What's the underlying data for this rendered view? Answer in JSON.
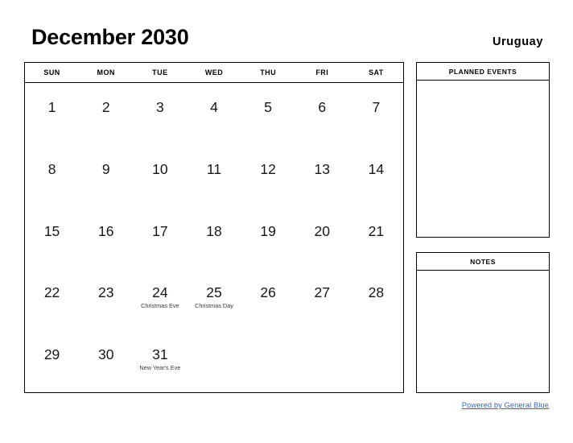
{
  "header": {
    "title": "December 2030",
    "country": "Uruguay"
  },
  "calendar": {
    "weekdays": [
      "SUN",
      "MON",
      "TUE",
      "WED",
      "THU",
      "FRI",
      "SAT"
    ],
    "weeks": [
      [
        {
          "day": "1",
          "event": ""
        },
        {
          "day": "2",
          "event": ""
        },
        {
          "day": "3",
          "event": ""
        },
        {
          "day": "4",
          "event": ""
        },
        {
          "day": "5",
          "event": ""
        },
        {
          "day": "6",
          "event": ""
        },
        {
          "day": "7",
          "event": ""
        }
      ],
      [
        {
          "day": "8",
          "event": ""
        },
        {
          "day": "9",
          "event": ""
        },
        {
          "day": "10",
          "event": ""
        },
        {
          "day": "11",
          "event": ""
        },
        {
          "day": "12",
          "event": ""
        },
        {
          "day": "13",
          "event": ""
        },
        {
          "day": "14",
          "event": ""
        }
      ],
      [
        {
          "day": "15",
          "event": ""
        },
        {
          "day": "16",
          "event": ""
        },
        {
          "day": "17",
          "event": ""
        },
        {
          "day": "18",
          "event": ""
        },
        {
          "day": "19",
          "event": ""
        },
        {
          "day": "20",
          "event": ""
        },
        {
          "day": "21",
          "event": ""
        }
      ],
      [
        {
          "day": "22",
          "event": ""
        },
        {
          "day": "23",
          "event": ""
        },
        {
          "day": "24",
          "event": "Christmas Eve"
        },
        {
          "day": "25",
          "event": "Christmas Day"
        },
        {
          "day": "26",
          "event": ""
        },
        {
          "day": "27",
          "event": ""
        },
        {
          "day": "28",
          "event": ""
        }
      ],
      [
        {
          "day": "29",
          "event": ""
        },
        {
          "day": "30",
          "event": ""
        },
        {
          "day": "31",
          "event": "New Year's Eve"
        },
        {
          "day": "",
          "event": ""
        },
        {
          "day": "",
          "event": ""
        },
        {
          "day": "",
          "event": ""
        },
        {
          "day": "",
          "event": ""
        }
      ]
    ]
  },
  "panels": {
    "planned_events_title": "PLANNED EVENTS",
    "notes_title": "NOTES"
  },
  "footer": {
    "link_text": "Powered by General Blue",
    "link_color": "#3366cc"
  }
}
